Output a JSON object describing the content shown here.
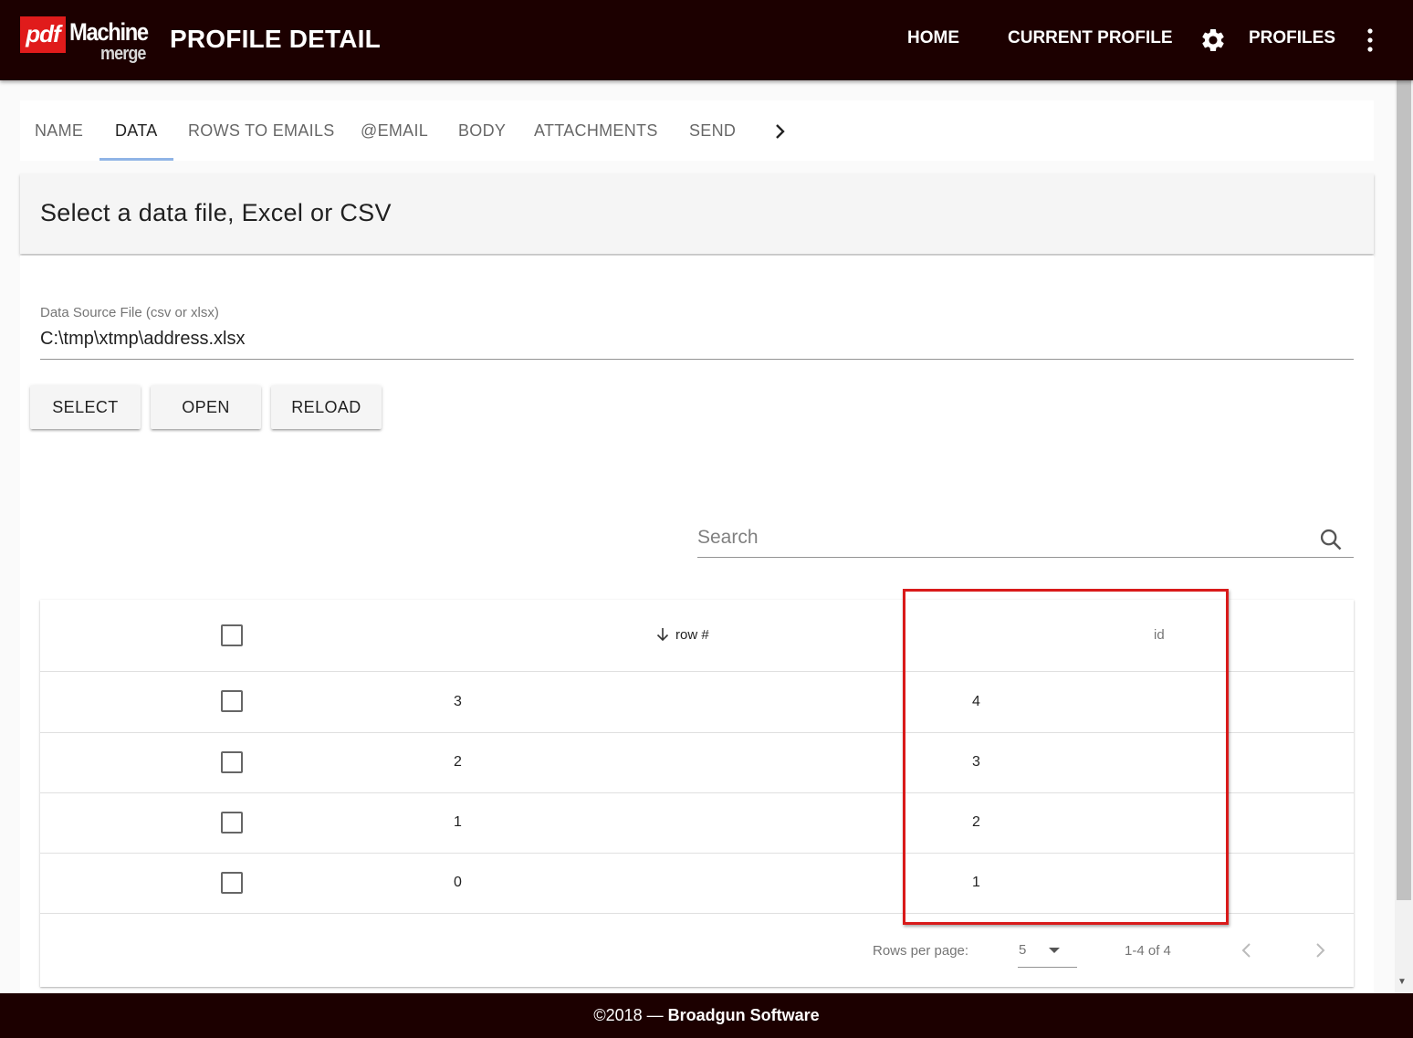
{
  "app": {
    "logo_pdf": "pdf",
    "logo_machine": "Machine",
    "logo_merge": "merge",
    "title": "PROFILE DETAIL"
  },
  "nav": {
    "home": "HOME",
    "current_profile": "CURRENT PROFILE",
    "settings_icon": "gear-icon",
    "profiles": "PROFILES",
    "more_icon": "more-vert-icon"
  },
  "tabs": [
    {
      "label": "NAME",
      "active": false
    },
    {
      "label": "DATA",
      "active": true
    },
    {
      "label": "ROWS TO EMAILS",
      "active": false
    },
    {
      "label": "@EMAIL",
      "active": false
    },
    {
      "label": "BODY",
      "active": false
    },
    {
      "label": "ATTACHMENTS",
      "active": false
    },
    {
      "label": "SEND",
      "active": false
    }
  ],
  "section": {
    "title": "Select a data file, Excel or CSV"
  },
  "data_source": {
    "label": "Data Source File (csv or xlsx)",
    "value": "C:\\tmp\\xtmp\\address.xlsx"
  },
  "buttons": {
    "select": "SELECT",
    "open": "OPEN",
    "reload": "RELOAD"
  },
  "search": {
    "placeholder": "Search"
  },
  "table": {
    "columns": {
      "row": "row #",
      "id": "id"
    },
    "rows": [
      {
        "row": "3",
        "id": "4"
      },
      {
        "row": "2",
        "id": "3"
      },
      {
        "row": "1",
        "id": "2"
      },
      {
        "row": "0",
        "id": "1"
      }
    ],
    "pagination": {
      "rows_per_page_label": "Rows per page:",
      "rows_per_page_value": "5",
      "range": "1-4 of 4"
    }
  },
  "footer": {
    "prefix": "©2018 — ",
    "company": "Broadgun Software"
  },
  "colors": {
    "appbar": "#1c0000",
    "highlight": "#d91a1a",
    "tab_indicator": "#90b4e6"
  }
}
